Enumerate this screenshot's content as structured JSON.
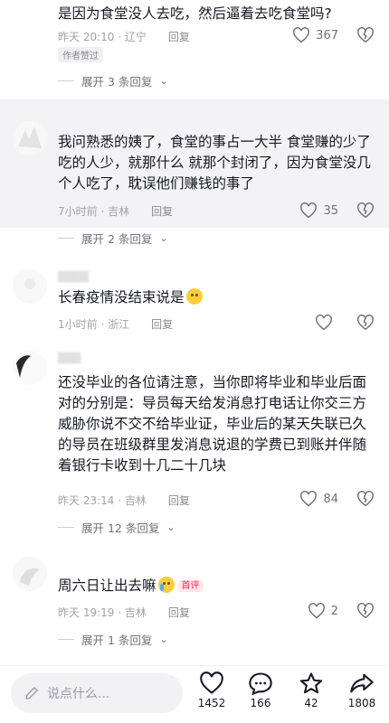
{
  "comments": [
    {
      "text": "是因为食堂没人去吃，然后逼着去吃食堂吗?",
      "time": "昨天 20:10 · 辽宁",
      "reply": "回复",
      "likes": "367",
      "author_tag": "作者赞过",
      "expand": "展开 3 条回复"
    },
    {
      "text": "我问熟悉的姨了，食堂的事占一大半 食堂赚的少了 吃的人少，就那什么 就那个封闭了，因为食堂没几个人吃了，耽误他们赚钱的事了",
      "time": "7小时前 · 吉林",
      "reply": "回复",
      "likes": "35",
      "expand": "展开 2 条回复"
    },
    {
      "text": "长春疫情没结束说是",
      "time": "1小时前 · 浙江",
      "reply": "回复",
      "likes": ""
    },
    {
      "text": "还没毕业的各位请注意，当你即将毕业和毕业后面对的分别是：导员每天给发消息打电话让你交三方威胁你说不交不给毕业证，毕业后的某天失联已久的导员在班级群里发消息说退的学费已到账并伴随着银行卡收到十几二十几块",
      "time": "昨天 23:14 · 吉林",
      "reply": "回复",
      "likes": "84",
      "expand": "展开 12 条回复"
    },
    {
      "text": "周六日让出去嘛",
      "first_tag": "首评",
      "time": "昨天 19:19 · 吉林",
      "reply": "回复",
      "likes": "2",
      "expand": "展开 1 条回复"
    }
  ],
  "bottom_bar": {
    "input_placeholder": "说点什么...",
    "likes": "1452",
    "comments": "166",
    "favorites": "42",
    "shares": "1808"
  },
  "icons": {
    "like": "heart-outline-icon",
    "dislike": "broken-heart-icon",
    "comment": "comment-bubble-icon",
    "favorite": "star-icon",
    "share": "share-arrow-icon",
    "edit": "pencil-icon"
  },
  "colors": {
    "text": "#161823",
    "meta": "#a2a3a8",
    "highlight_bg": "#f3f3f5",
    "first_tag": "#fe2c55"
  }
}
